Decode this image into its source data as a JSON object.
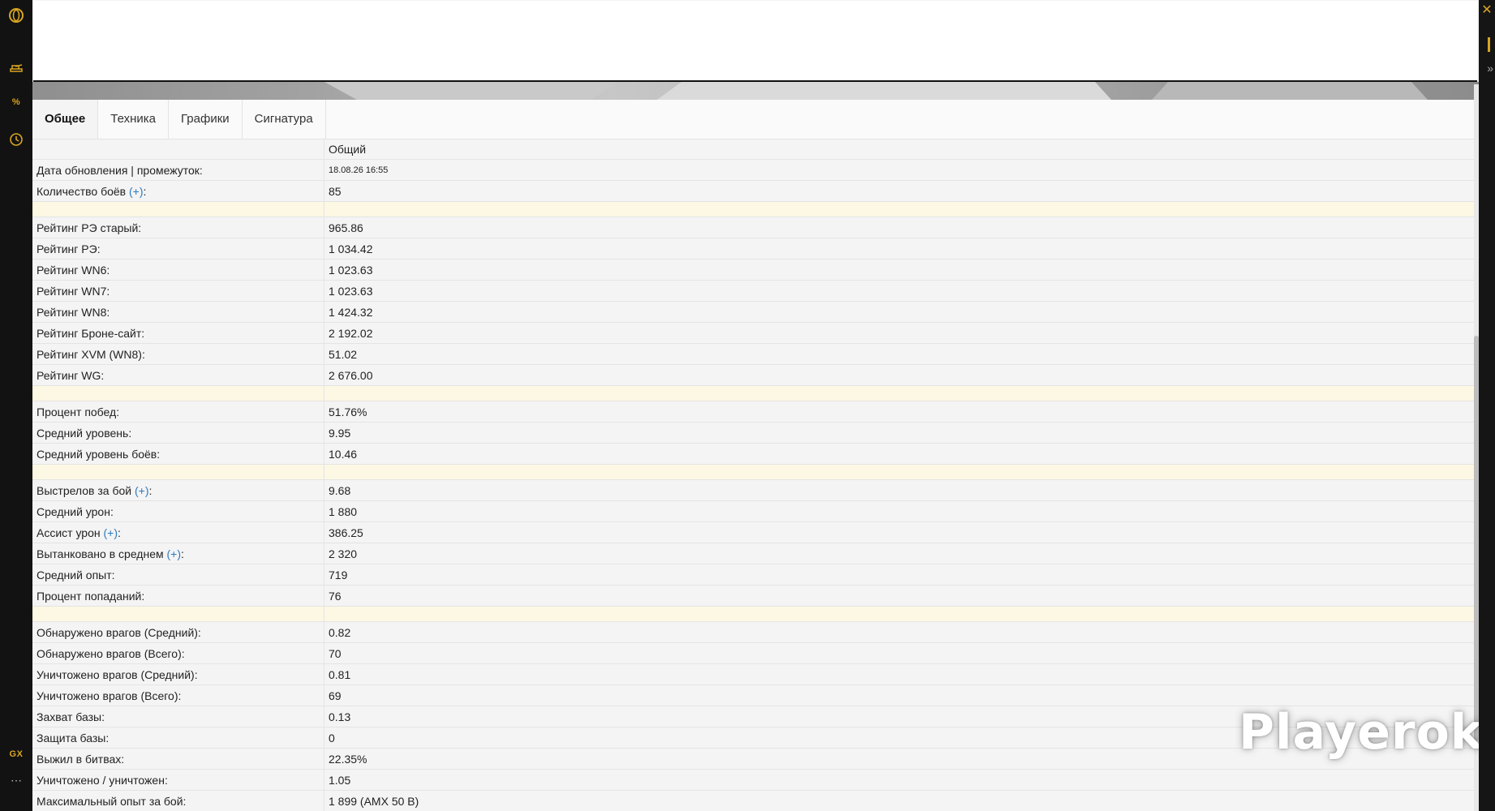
{
  "sidebar": {
    "items": [
      {
        "icon": "opera-logo-icon"
      },
      {
        "icon": "tank-icon"
      },
      {
        "icon": "percent-icon",
        "label": "%"
      },
      {
        "icon": "clock-icon"
      },
      {
        "icon": "gx-icon",
        "label": "GX"
      },
      {
        "icon": "more-icon",
        "label": "⋯"
      }
    ]
  },
  "window": {
    "close_label": "✕",
    "expand_label": "»"
  },
  "tabs": [
    {
      "label": "Общее",
      "active": true
    },
    {
      "label": "Техника"
    },
    {
      "label": "Графики"
    },
    {
      "label": "Сигнатура"
    }
  ],
  "table": {
    "column_header": "Общий",
    "plus_label": "(+)",
    "rows": [
      {
        "label": "Дата обновления | промежуток:",
        "value": "18.08.26 16:55",
        "color": "gray"
      },
      {
        "label": "Количество боёв",
        "plus": true,
        "value": "85",
        "color": "red"
      },
      {
        "separator": true
      },
      {
        "label": "Рейтинг РЭ старый:",
        "value": "965.86",
        "color": "yellow"
      },
      {
        "label": "Рейтинг РЭ:",
        "value": "1 034.42",
        "color": "yellow"
      },
      {
        "label": "Рейтинг WN6:",
        "value": "1 023.63",
        "color": "yellow"
      },
      {
        "label": "Рейтинг WN7:",
        "value": "1 023.63",
        "color": "yellow"
      },
      {
        "label": "Рейтинг WN8:",
        "value": "1 424.32",
        "color": "yellow"
      },
      {
        "label": "Рейтинг Броне-сайт:",
        "value": "2 192.02",
        "color": "yellow"
      },
      {
        "label": "Рейтинг XVM (WN8):",
        "value": "51.02",
        "color": "yellow"
      },
      {
        "label": "Рейтинг WG:",
        "value": "2 676.00",
        "color": "red"
      },
      {
        "separator": true
      },
      {
        "label": "Процент побед:",
        "value": "51.76%",
        "color": "yellow"
      },
      {
        "label": "Средний уровень:",
        "value": "9.95",
        "color": "purple"
      },
      {
        "label": "Средний уровень боёв:",
        "value": "10.46",
        "color": "purple"
      },
      {
        "separator": true
      },
      {
        "label": "Выстрелов за бой",
        "plus": true,
        "value": "9.68",
        "color": "default"
      },
      {
        "label": "Средний урон:",
        "value": "1 880",
        "color": "cyan"
      },
      {
        "label": "Ассист урон",
        "plus": true,
        "value": "386.25",
        "color": "default"
      },
      {
        "label": "Вытанковано в среднем",
        "plus": true,
        "value": "2 320",
        "color": "default"
      },
      {
        "label": "Средний опыт:",
        "value": "719",
        "color": "default"
      },
      {
        "label": "Процент попаданий:",
        "value": "76",
        "color": "cyan"
      },
      {
        "separator": true
      },
      {
        "label": "Обнаружено врагов (Средний):",
        "value": "0.82",
        "color": "yellow"
      },
      {
        "label": "Обнаружено врагов (Всего):",
        "value": "70",
        "color": "default"
      },
      {
        "label": "Уничтожено врагов (Средний):",
        "value": "0.81",
        "color": "yellow"
      },
      {
        "label": "Уничтожено врагов (Всего):",
        "value": "69",
        "color": "default"
      },
      {
        "label": "Захват базы:",
        "value": "0.13",
        "color": "default"
      },
      {
        "label": "Защита базы:",
        "value": "0",
        "color": "default"
      },
      {
        "label": "Выжил в битвах:",
        "value": "22.35%",
        "color": "default"
      },
      {
        "label": "Уничтожено / уничтожен:",
        "value": "1.05",
        "color": "default"
      },
      {
        "label": "Максимальный опыт за бой:",
        "value": "1 899 (AMX 50 B)",
        "color": "default"
      }
    ]
  },
  "watermark": "Playerok",
  "colors": {
    "accent": "#d9a521",
    "red": "#d21b1b",
    "yellow": "#c8b216",
    "purple": "#b33fe0",
    "cyan": "#20a8d6",
    "separator": "#fcf8e3"
  }
}
